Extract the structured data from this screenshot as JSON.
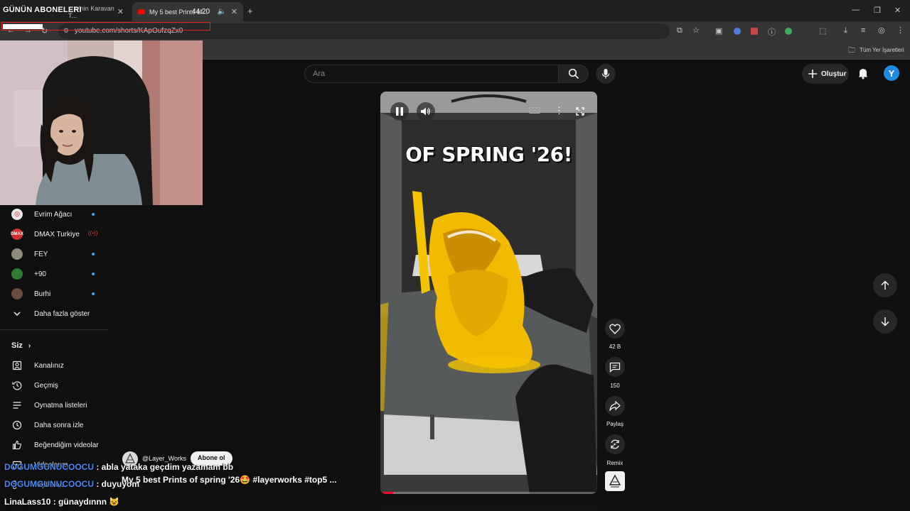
{
  "overlay": {
    "title": "GÜNÜN ABONELERI"
  },
  "browser": {
    "tabs": [
      {
        "label": "...te'nin Karavan T..."
      },
      {
        "label": "My 5 best Prints of...",
        "timer": "44:20"
      }
    ],
    "url": "youtube.com/shorts/KApOufzqZx0",
    "bookmarks_label": "Tüm Yer İşaretleri"
  },
  "header": {
    "search_placeholder": "Ara",
    "create_label": "Oluştur",
    "avatar_letter": "Y"
  },
  "sidebar": {
    "subscriptions": [
      {
        "name": "Evrim Ağacı",
        "color": "#e53935",
        "abbr": "E",
        "indicator": "dot"
      },
      {
        "name": "DMAX Turkiye",
        "color": "#d32f2f",
        "abbr": "DMAX",
        "indicator": "live"
      },
      {
        "name": "FEY",
        "color": "#8d8d7a",
        "abbr": "F",
        "indicator": "dot"
      },
      {
        "name": "+90",
        "color": "#2e7d32",
        "abbr": "+90",
        "indicator": "dot"
      },
      {
        "name": "Burhi",
        "color": "#6d4c41",
        "abbr": "B",
        "indicator": "dot"
      }
    ],
    "show_more": "Daha fazla göster",
    "you_section": "Siz",
    "you_items": [
      {
        "label": "Kanalınız",
        "icon": "account-box-icon"
      },
      {
        "label": "Geçmiş",
        "icon": "history-icon"
      },
      {
        "label": "Oynatma listeleri",
        "icon": "playlist-icon"
      },
      {
        "label": "Daha sonra izle",
        "icon": "clock-icon"
      },
      {
        "label": "Beğendiğim videolar",
        "icon": "thumb-up-icon"
      },
      {
        "label": "Videolarım",
        "icon": "video-icon"
      },
      {
        "label": "Klipleriniz",
        "icon": "scissors-icon"
      }
    ]
  },
  "video": {
    "caption": "OF SPRING '26!",
    "progress": 0.06,
    "channel": "@Layer_Works",
    "subscribe_label": "Abone ol",
    "title": "My 5 best Prints of spring '26🤩 #layerworks #top5 ..."
  },
  "actions": {
    "likes": "42 B",
    "comments": "150",
    "share": "Paylaş",
    "remix": "Remix"
  },
  "chat": [
    {
      "user": "DOGUMGUNUCOOCU",
      "message": " : abla yataka geçdim yazamam bb"
    },
    {
      "user": "DOGUMGUNUCOOCU",
      "message": " : duyuyom"
    },
    {
      "user": "LinaLass10",
      "message": " : günaydınnn 😺"
    }
  ]
}
